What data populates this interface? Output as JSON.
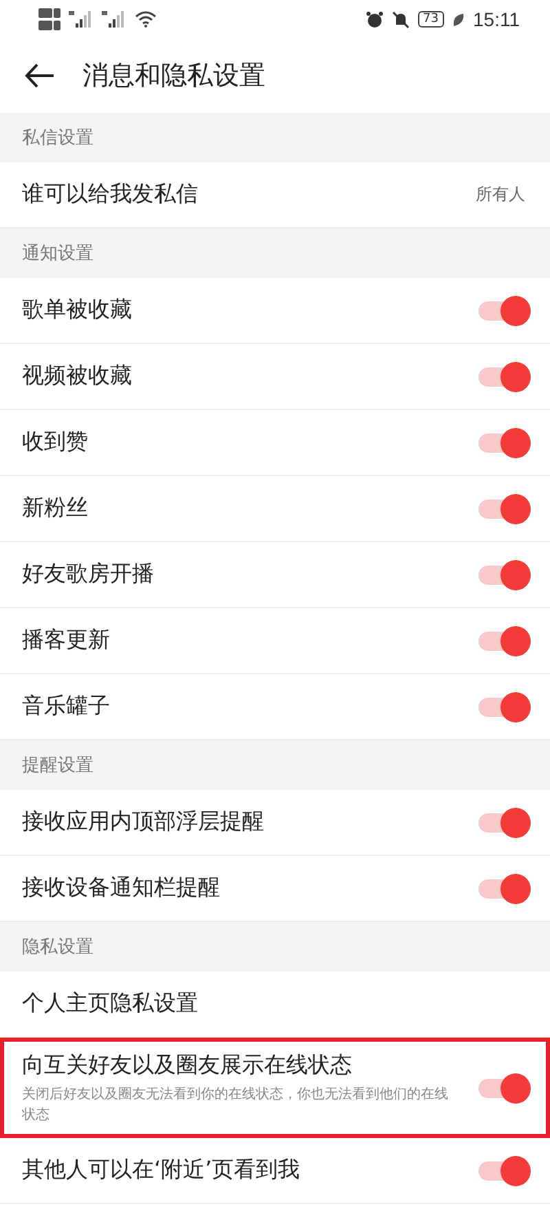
{
  "status_bar": {
    "time": "15:11",
    "battery": "73"
  },
  "header": {
    "title": "消息和隐私设置"
  },
  "sections": [
    {
      "title": "私信设置",
      "items": [
        {
          "kind": "value",
          "label": "谁可以给我发私信",
          "value": "所有人"
        }
      ]
    },
    {
      "title": "通知设置",
      "items": [
        {
          "kind": "toggle",
          "label": "歌单被收藏",
          "on": true
        },
        {
          "kind": "toggle",
          "label": "视频被收藏",
          "on": true
        },
        {
          "kind": "toggle",
          "label": "收到赞",
          "on": true
        },
        {
          "kind": "toggle",
          "label": "新粉丝",
          "on": true
        },
        {
          "kind": "toggle",
          "label": "好友歌房开播",
          "on": true
        },
        {
          "kind": "toggle",
          "label": "播客更新",
          "on": true
        },
        {
          "kind": "toggle",
          "label": "音乐罐子",
          "on": true
        }
      ]
    },
    {
      "title": "提醒设置",
      "items": [
        {
          "kind": "toggle",
          "label": "接收应用内顶部浮层提醒",
          "on": true
        },
        {
          "kind": "toggle",
          "label": "接收设备通知栏提醒",
          "on": true
        }
      ]
    },
    {
      "title": "隐私设置",
      "items": [
        {
          "kind": "link",
          "label": "个人主页隐私设置"
        },
        {
          "kind": "toggle",
          "label": "向互关好友以及圈友展示在线状态",
          "description": "关闭后好友以及圈友无法看到你的在线状态，你也无法看到他们的在线状态",
          "on": true,
          "highlighted": true
        },
        {
          "kind": "toggle",
          "label": "其他人可以在‘附近’页看到我",
          "on": true
        }
      ]
    }
  ]
}
